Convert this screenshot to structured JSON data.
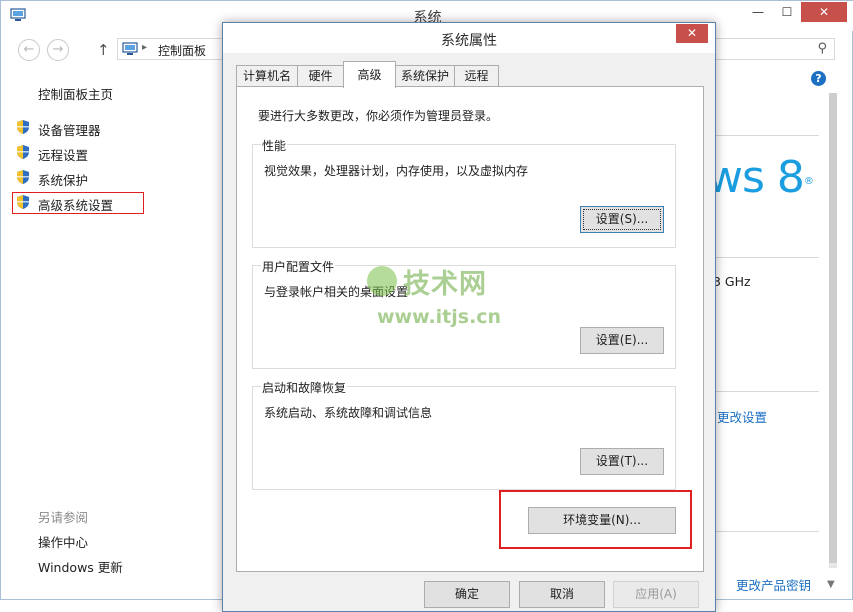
{
  "window": {
    "title": "系统",
    "controls": {
      "minimize": "—",
      "maximize": "☐",
      "close": "✕"
    }
  },
  "addressbar": {
    "back": "←",
    "forward": "→",
    "up": "↑",
    "separator": "▸",
    "breadcrumb": "控制面板",
    "search_icon": "⚲"
  },
  "sidebar": {
    "home": "控制面板主页",
    "items": [
      {
        "label": "设备管理器",
        "icon": "shield-icon"
      },
      {
        "label": "远程设置",
        "icon": "shield-icon"
      },
      {
        "label": "系统保护",
        "icon": "shield-icon"
      },
      {
        "label": "高级系统设置",
        "icon": "shield-icon",
        "highlighted": true
      }
    ],
    "see_also_title": "另请参阅",
    "see_also": [
      "操作中心",
      "Windows 更新"
    ]
  },
  "right_pane": {
    "help": "?",
    "logo_text": "ws 8",
    "logo_trademark": "®",
    "cpu_speed_fragment": "3 GHz",
    "change_settings": "更改设置",
    "change_product_key": "更改产品密钥"
  },
  "dialog": {
    "title": "系统属性",
    "close": "✕",
    "tabs": [
      {
        "label": "计算机名",
        "active": false
      },
      {
        "label": "硬件",
        "active": false
      },
      {
        "label": "高级",
        "active": true
      },
      {
        "label": "系统保护",
        "active": false
      },
      {
        "label": "远程",
        "active": false
      }
    ],
    "intro": "要进行大多数更改，你必须作为管理员登录。",
    "groups": [
      {
        "legend": "性能",
        "desc": "视觉效果，处理器计划，内存使用，以及虚拟内存",
        "button": "设置(S)..."
      },
      {
        "legend": "用户配置文件",
        "desc": "与登录帐户相关的桌面设置",
        "button": "设置(E)..."
      },
      {
        "legend": "启动和故障恢复",
        "desc": "系统启动、系统故障和调试信息",
        "button": "设置(T)..."
      }
    ],
    "env_button": "环境变量(N)...",
    "ok": "确定",
    "cancel": "取消",
    "apply": "应用(A)"
  },
  "watermark": {
    "name": "技术网",
    "url": "www.itjs.cn"
  },
  "colors": {
    "accent": "#1a9ee0",
    "link": "#1a6fc2",
    "highlight": "#e02020",
    "close": "#c7504b"
  }
}
